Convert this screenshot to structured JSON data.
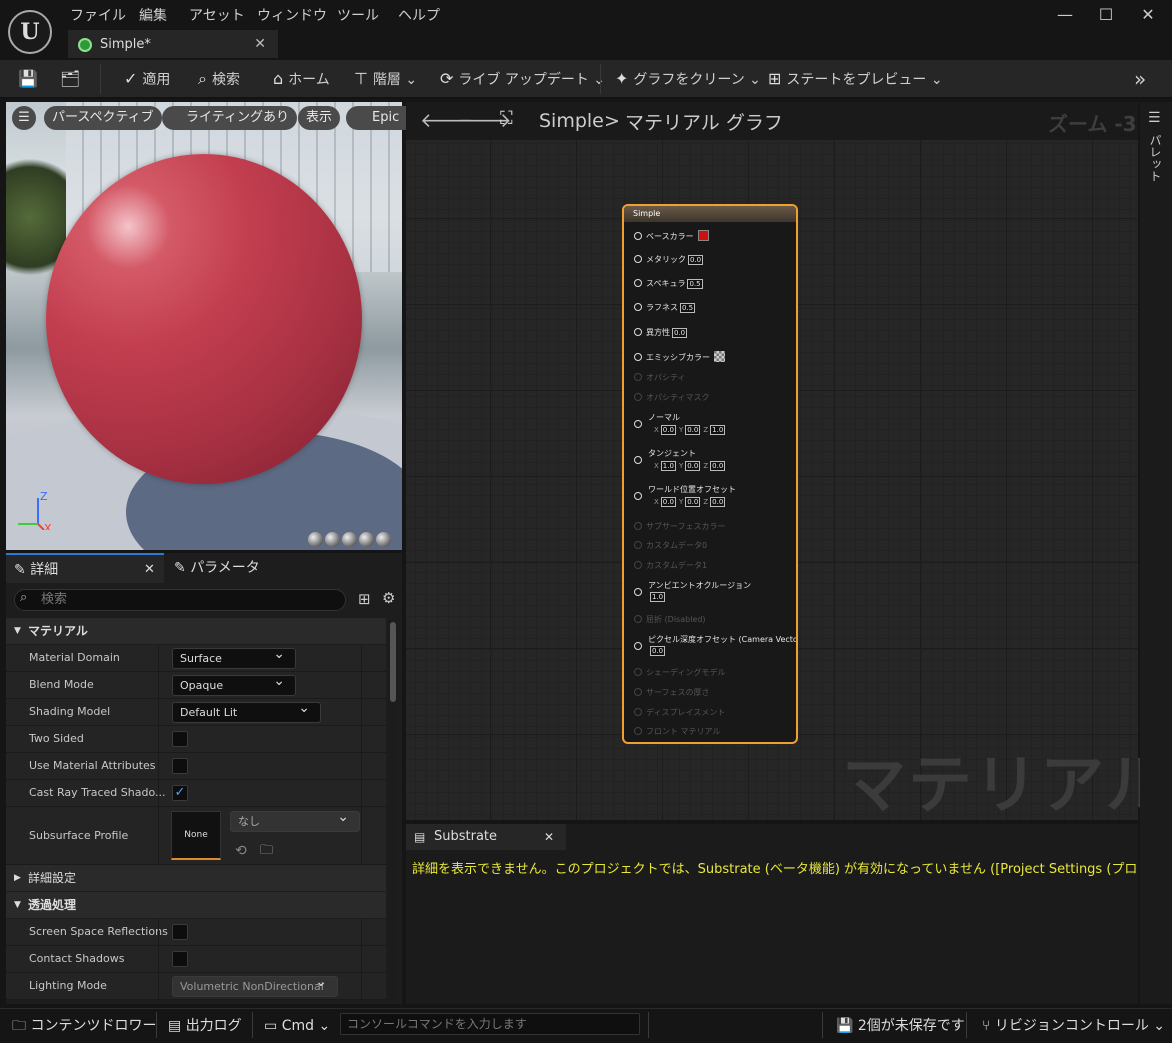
{
  "menu": [
    "ファイル",
    "編集",
    "アセット",
    "ウィンドウ",
    "ツール",
    "ヘルプ"
  ],
  "tab": {
    "title": "Simple*"
  },
  "toolbar": {
    "apply": "適用",
    "search": "検索",
    "home": "ホーム",
    "hierarchy": "階層",
    "live_update": "ライブ アップデート",
    "clean_graph": "グラフをクリーン",
    "preview_state": "ステートをプレビュー"
  },
  "viewport": {
    "perspective": "パースペクティブ",
    "lighting": "ライティングあり",
    "show": "表示",
    "epic": "Epic",
    "axis_z": "Z",
    "axis_x": "X"
  },
  "details": {
    "tab_details": "詳細",
    "tab_params": "パラメータ",
    "search_placeholder": "検索",
    "cat_material": "マテリアル",
    "cat_advanced": "詳細設定",
    "cat_translucency": "透過処理",
    "rows": {
      "material_domain": {
        "label": "Material Domain",
        "value": "Surface"
      },
      "blend_mode": {
        "label": "Blend Mode",
        "value": "Opaque"
      },
      "shading_model": {
        "label": "Shading Model",
        "value": "Default Lit"
      },
      "two_sided": {
        "label": "Two Sided"
      },
      "use_material_attributes": {
        "label": "Use Material Attributes"
      },
      "cast_ray_traced": {
        "label": "Cast Ray Traced Shado..."
      },
      "subsurface_profile": {
        "label": "Subsurface Profile",
        "thumb": "None",
        "value": "なし"
      },
      "ssr": {
        "label": "Screen Space Reflections"
      },
      "contact_shadows": {
        "label": "Contact Shadows"
      },
      "lighting_mode": {
        "label": "Lighting Mode",
        "value": "Volumetric NonDirectional"
      }
    }
  },
  "graph": {
    "breadcrumb_root": "Simple",
    "breadcrumb_sep": ">",
    "breadcrumb_current": "マテリアル グラフ",
    "zoom": "ズーム -3",
    "watermark": "マテリアル",
    "palette": "パレット"
  },
  "node": {
    "title": "Simple",
    "pins": {
      "base_color": "ベースカラー",
      "metallic": "メタリック",
      "metallic_v": "0.0",
      "specular": "スペキュラ",
      "specular_v": "0.5",
      "roughness": "ラフネス",
      "roughness_v": "0.5",
      "anisotropy": "異方性",
      "anisotropy_v": "0.0",
      "emissive": "エミッシブカラー",
      "opacity": "オパシティ",
      "opacity_mask": "オパシティマスク",
      "normal": "ノーマル",
      "tangent": "タンジェント",
      "wpo": "ワールド位置オフセット",
      "subsurface_color": "サブサーフェスカラー",
      "custom0": "カスタムデータ0",
      "custom1": "カスタムデータ1",
      "ao": "アンビエントオクルージョン",
      "ao_v": "1.0",
      "refraction": "屈折 (Disabled)",
      "pdo": "ピクセル深度オフセット (Camera Vector)",
      "pdo_v": "0.0",
      "shading_model": "シェーディングモデル",
      "surface_thickness": "サーフェスの厚さ",
      "displacement": "ディスプレイスメント",
      "front_material": "フロント マテリアル"
    },
    "normal_xyz": [
      "0.0",
      "0.0",
      "1.0"
    ],
    "tangent_xyz": [
      "1.0",
      "0.0",
      "0.0"
    ],
    "wpo_xyz": [
      "0.0",
      "0.0",
      "0.0"
    ],
    "axis_labels": [
      "X",
      "Y",
      "Z"
    ],
    "base_color_hex": "#cc1111"
  },
  "substrate": {
    "tab": "Substrate",
    "message": "詳細を表示できません。このプロジェクトでは、Substrate (ベータ機能) が有効になっていません ([Project Settings (プロジェクト設定)"
  },
  "statusbar": {
    "content_drawer": "コンテンツドロワー",
    "output_log": "出力ログ",
    "cmd": "Cmd",
    "console_placeholder": "コンソールコマンドを入力します",
    "unsaved": "2個が未保存です",
    "revision_control": "リビジョンコントロール"
  }
}
